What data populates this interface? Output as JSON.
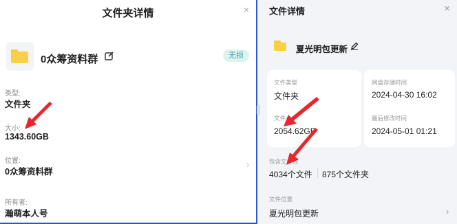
{
  "left": {
    "title": "文件夹详情",
    "close": "×",
    "folder_name": "0众筹资料群",
    "badge": "无损",
    "type_label": "类型:",
    "type_value": "文件夹",
    "size_label": "大小:",
    "size_value": "1343.60GB",
    "location_label": "位置:",
    "location_value": "0众筹资料群",
    "owner_label": "所有者:",
    "owner_value": "瀚萌本人号",
    "chevron": "›"
  },
  "right": {
    "title": "文件详情",
    "close": "×",
    "folder_name": "夏光明包更新",
    "file_type_label": "文件类型",
    "file_type_value": "文件夹",
    "stored_time_label": "网盘存储时间",
    "stored_time_value": "2024-04-30 16:02",
    "size_label": "文件大小",
    "size_value": "2054.62GB",
    "modified_label": "最后修改时间",
    "modified_value": "2024-05-01 01:21",
    "contains_label": "包含文件数",
    "files_count": "4034个文件",
    "folders_count": "875个文件夹",
    "location_label": "文件位置",
    "location_value": "夏光明包更新",
    "chevron": "›"
  },
  "colors": {
    "accent_border": "#2a56c6",
    "arrow": "#e8262c",
    "folder": "#f8cf45",
    "badge_text": "#3aa3b4",
    "badge_bg": "#dff3ee"
  },
  "icons": [
    "folder-icon",
    "edit-icon",
    "close-icon",
    "chevron-right-icon",
    "arrow-annotation"
  ]
}
